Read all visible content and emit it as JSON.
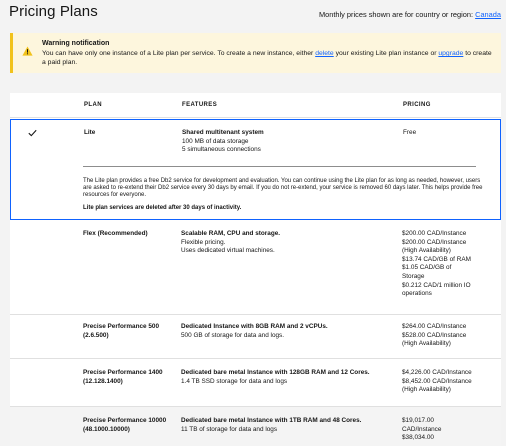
{
  "header": {
    "title": "Pricing Plans",
    "region_prefix": "Monthly prices shown are for country or region: ",
    "region_link": "Canada"
  },
  "warning": {
    "icon": "warning-triangle-icon",
    "title": "Warning notification",
    "msg_part1": "You can have only one instance of a Lite plan per service. To create a new instance, either ",
    "link_delete": "delete",
    "msg_part2": " your existing Lite plan instance or ",
    "link_upgrade": "upgrade",
    "msg_part3": " to create a paid plan."
  },
  "table": {
    "headers": {
      "plan": "PLAN",
      "features": "FEATURES",
      "pricing": "PRICING"
    },
    "rows": [
      {
        "selected": true,
        "plan": "Lite",
        "features": [
          "Shared multitenant system",
          "100 MB of data storage",
          "5 simultaneous connections"
        ],
        "pricing": [
          "Free"
        ],
        "description": "The Lite plan provides a free Db2 service for development and evaluation. You can continue using the Lite plan for as long as needed, however, users are asked to re-extend their Db2 service every 30 days by email. If you do not re-extend, your service is removed 60 days later. This helps provide free resources for everyone.",
        "note": "Lite plan services are deleted after 30 days of inactivity."
      },
      {
        "plan": "Flex (Recommended)",
        "features": [
          "Scalable RAM, CPU and storage.",
          "Flexible pricing.",
          "Uses dedicated virtual machines."
        ],
        "pricing": [
          "$200.00 CAD/Instance",
          "$200.00 CAD/Instance",
          "(High Availability)",
          "$13.74 CAD/GB of RAM",
          "$1.05 CAD/GB of",
          "Storage",
          "$0.212 CAD/1 million IO",
          "operations"
        ]
      },
      {
        "plan": "Precise Performance 500",
        "plan2": "(2.6.500)",
        "features": [
          "Dedicated Instance with 8GB RAM and 2 vCPUs.",
          "500 GB of storage for data and logs."
        ],
        "pricing": [
          "$264.00 CAD/Instance",
          "$528.00 CAD/Instance",
          "(High Availability)"
        ]
      },
      {
        "plan": "Precise Performance 1400",
        "plan2": "(12.128.1400)",
        "features": [
          "Dedicated bare metal Instance with 128GB RAM and 12 Cores.",
          "1.4 TB SSD storage for data and logs"
        ],
        "pricing": [
          "$4,226.00 CAD/Instance",
          "$8,452.00 CAD/Instance",
          "(High Availability)"
        ]
      },
      {
        "plan": "Precise Performance 10000",
        "plan2": "(48.1000.10000)",
        "features": [
          "Dedicated bare metal Instance with 1TB RAM and 48 Cores.",
          "11 TB of storage for data and logs"
        ],
        "pricing": [
          "$19,017.00",
          "CAD/Instance",
          "$38,034.00"
        ]
      }
    ]
  }
}
